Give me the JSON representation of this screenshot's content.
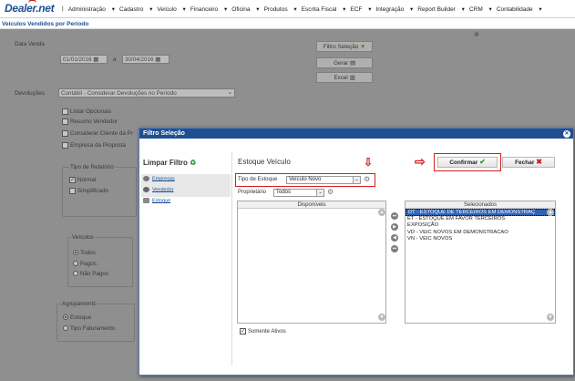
{
  "app": {
    "logo": "Dealer.net"
  },
  "menu": [
    "Administração",
    "Cadastro",
    "Veículo",
    "Financeiro",
    "Oficina",
    "Produtos",
    "Escrita Fiscal",
    "ECF",
    "Integração",
    "Report Builder",
    "CRM",
    "Contabilidade"
  ],
  "page": {
    "title": "Veículos Vendidos por Período"
  },
  "background": {
    "data_venda_label": "Data Venda",
    "date_from": "01/01/2016",
    "date_sep": "a",
    "date_to": "30/04/2016",
    "filtro_selecao_btn": "Filtro Seleção",
    "gerar_btn": "Gerar",
    "excel_btn": "Excel",
    "devolucoes_label": "Devoluções",
    "devolucoes_value": "Contábil - Considerar Devoluções no Período",
    "checks": [
      "Listar Opcionais",
      "Resumo Vendedor",
      "Considerar Cliente da Pr",
      "Empresa da Proposta"
    ],
    "tipo_relatorio": {
      "title": "Tipo de Relatório",
      "options": [
        "Normal",
        "Simplificado"
      ]
    },
    "veiculos": {
      "title": "Veículos",
      "options": [
        "Todos",
        "Pagos",
        "Não Pagos"
      ]
    },
    "agrupamento": {
      "title": "Agrupamento",
      "options": [
        "Estoque",
        "Tipo Faturamento"
      ]
    }
  },
  "modal": {
    "title": "Filtro Seleção",
    "limpar_filtro": "Limpar Filtro",
    "nav": [
      "Empresas",
      "Vendedor",
      "Estoque"
    ],
    "section_title": "Estoque Veículo",
    "confirmar": "Confirmar",
    "fechar": "Fechar",
    "tipo_estoque_label": "Tipo de Estoque",
    "tipo_estoque_value": "Veículo Novo",
    "proprietario_label": "Proprietário",
    "proprietario_value": "Todos",
    "disponiveis_header": "Disponíveis",
    "selecionados_header": "Selecionados",
    "selecionados": [
      "DT - ESTOQUE DE TERCEIROS EM DEMONSTRAÇ",
      "ET - ESTOQUE EM FAVOR TERCEIROS",
      "EXPOSIÇÃO",
      "VD - VEIC NOVOS EM DEMONSTRACAO",
      "VN - VEIC NOVOS"
    ],
    "somente_ativos": "Somente Ativos"
  }
}
